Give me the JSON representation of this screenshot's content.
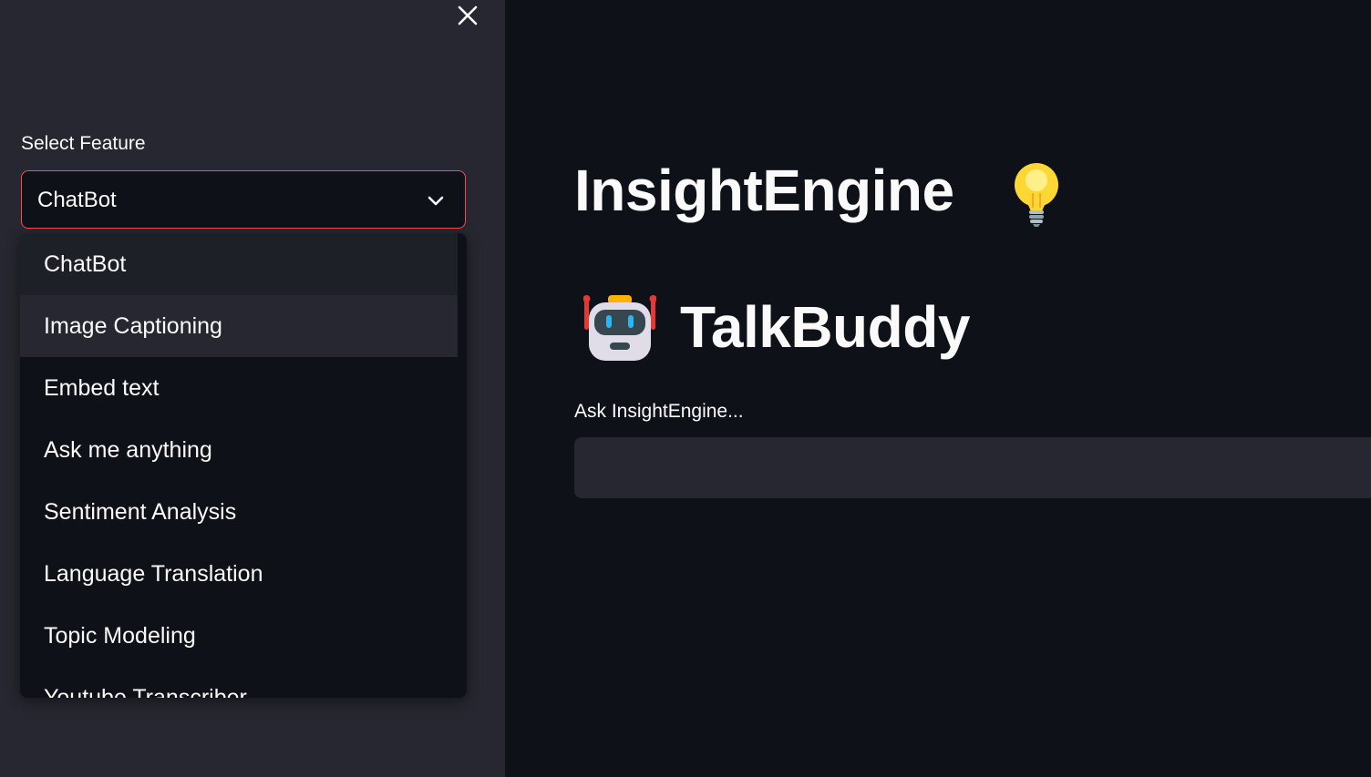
{
  "sidebar": {
    "select_label": "Select Feature",
    "selected_value": "ChatBot",
    "options": [
      "ChatBot",
      "Image Captioning",
      "Embed text",
      "Ask me anything",
      "Sentiment Analysis",
      "Language Translation",
      "Topic Modeling",
      "Youtube Transcriber"
    ],
    "hovered_option": "Image Captioning",
    "close_icon": "close-icon",
    "dropdown_icon": "chevron-down-icon"
  },
  "main": {
    "title": "InsightEngine",
    "title_icon": "lightbulb-icon",
    "subtitle": "TalkBuddy",
    "subtitle_icon": "robot-icon",
    "input_label": "Ask InsightEngine...",
    "input_value": ""
  },
  "colors": {
    "background": "#0e1117",
    "sidebar": "#262730",
    "accent": "#ff4b4b",
    "text": "#fafafa"
  }
}
